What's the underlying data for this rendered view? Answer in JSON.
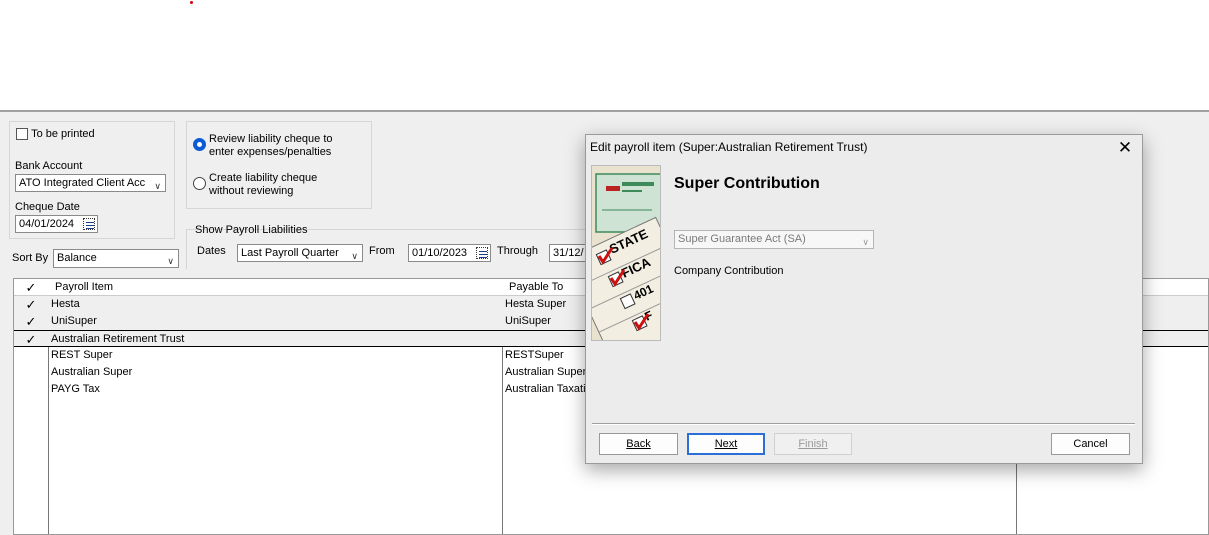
{
  "header": {
    "to_be_printed_label": "To be printed",
    "bank_account_label": "Bank Account",
    "bank_account_value": "ATO Integrated Client Acc",
    "cheque_date_label": "Cheque Date",
    "cheque_date_value": "04/01/2024",
    "review_option": "Review liability cheque to enter expenses/penalties",
    "review_option_line1": "Review liability cheque to",
    "review_option_line2": "enter expenses/penalties",
    "create_option_line1": "Create liability cheque",
    "create_option_line2": "without reviewing",
    "show_payroll_liabilities_label": "Show Payroll Liabilities",
    "dates_label": "Dates",
    "dates_value": "Last Payroll Quarter",
    "from_label": "From",
    "from_value": "01/10/2023",
    "through_label": "Through",
    "through_value": "31/12/",
    "sort_by_label": "Sort By",
    "sort_by_value": "Balance"
  },
  "table": {
    "check_header": "✓",
    "col_payroll_item": "Payroll Item",
    "col_payable_to": "Payable To",
    "rows": [
      {
        "check": "✓",
        "item": "Hesta",
        "payable": "Hesta Super"
      },
      {
        "check": "✓",
        "item": "UniSuper",
        "payable": "UniSuper"
      },
      {
        "check": "✓",
        "item": "Australian Retirement Trust",
        "payable": ""
      },
      {
        "check": "",
        "item": "REST Super",
        "payable": "RESTSuper"
      },
      {
        "check": "",
        "item": "Australian Super",
        "payable": "Australian Super"
      },
      {
        "check": "",
        "item": "PAYG Tax",
        "payable": "Australian Taxati"
      }
    ]
  },
  "dialog": {
    "title": "Edit payroll item (Super:Australian Retirement Trust)",
    "close_glyph": "✕",
    "heading": "Super Contribution",
    "select_value": "Super Guarantee Act (SA)",
    "company_contribution_label": "Company Contribution",
    "image_words": [
      "STATE",
      "FICA",
      "401",
      "F"
    ],
    "buttons": {
      "back": "Back",
      "next": "Next",
      "finish": "Finish",
      "cancel": "Cancel"
    }
  },
  "colors": {
    "accent": "#0a5bd6",
    "check_red": "#cc1111",
    "check_green": "#3e8a5a"
  }
}
